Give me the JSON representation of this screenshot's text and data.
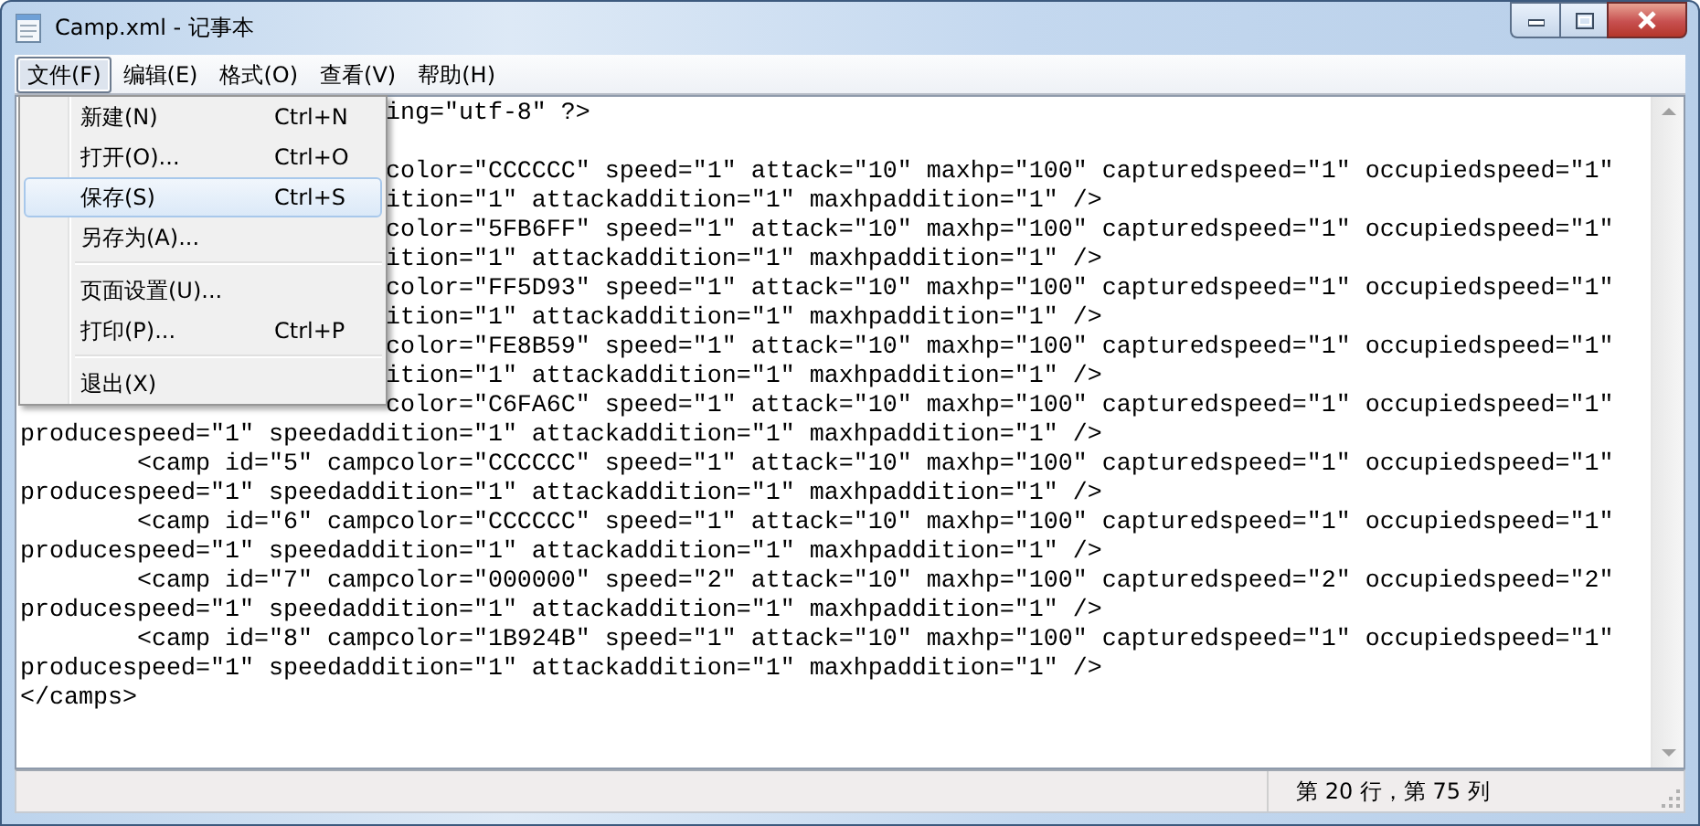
{
  "window": {
    "title": "Camp.xml - 记事本"
  },
  "menu_bar": [
    {
      "label": "文件(F)",
      "selected": true
    },
    {
      "label": "编辑(E)",
      "selected": false
    },
    {
      "label": "格式(O)",
      "selected": false
    },
    {
      "label": "查看(V)",
      "selected": false
    },
    {
      "label": "帮助(H)",
      "selected": false
    }
  ],
  "file_menu": [
    {
      "kind": "item",
      "label": "新建(N)",
      "shortcut": "Ctrl+N",
      "selected": false
    },
    {
      "kind": "item",
      "label": "打开(O)...",
      "shortcut": "Ctrl+O",
      "selected": false
    },
    {
      "kind": "item",
      "label": "保存(S)",
      "shortcut": "Ctrl+S",
      "selected": true
    },
    {
      "kind": "item",
      "label": "另存为(A)...",
      "selected": false
    },
    {
      "kind": "separator"
    },
    {
      "kind": "item",
      "label": "页面设置(U)...",
      "selected": false
    },
    {
      "kind": "item",
      "label": "打印(P)...",
      "shortcut": "Ctrl+P",
      "selected": false
    },
    {
      "kind": "separator"
    },
    {
      "kind": "item",
      "label": "退出(X)",
      "selected": false
    }
  ],
  "editor": {
    "lines": [
      {
        "kind": "under_menu",
        "text": "ing=\"utf-8\" ?>"
      },
      {
        "kind": "hidden"
      },
      {
        "kind": "under_menu",
        "text": "color=\"CCCCCC\" speed=\"1\" attack=\"10\" maxhp=\"100\" capturedspeed=\"1\" occupiedspeed=\"1\""
      },
      {
        "kind": "under_menu",
        "text": "ition=\"1\" attackaddition=\"1\" maxhpaddition=\"1\" />"
      },
      {
        "kind": "under_menu",
        "text": "color=\"5FB6FF\" speed=\"1\" attack=\"10\" maxhp=\"100\" capturedspeed=\"1\" occupiedspeed=\"1\""
      },
      {
        "kind": "under_menu",
        "text": "ition=\"1\" attackaddition=\"1\" maxhpaddition=\"1\" />"
      },
      {
        "kind": "under_menu",
        "text": "color=\"FF5D93\" speed=\"1\" attack=\"10\" maxhp=\"100\" capturedspeed=\"1\" occupiedspeed=\"1\""
      },
      {
        "kind": "under_menu",
        "text": "ition=\"1\" attackaddition=\"1\" maxhpaddition=\"1\" />"
      },
      {
        "kind": "under_menu",
        "text": "color=\"FE8B59\" speed=\"1\" attack=\"10\" maxhp=\"100\" capturedspeed=\"1\" occupiedspeed=\"1\""
      },
      {
        "kind": "under_menu",
        "text": "ition=\"1\" attackaddition=\"1\" maxhpaddition=\"1\" />"
      },
      {
        "kind": "under_menu",
        "text": "color=\"C6FA6C\" speed=\"1\" attack=\"10\" maxhp=\"100\" capturedspeed=\"1\" occupiedspeed=\"1\""
      },
      {
        "kind": "plain",
        "text": "producespeed=\"1\" speedaddition=\"1\" attackaddition=\"1\" maxhpaddition=\"1\" />"
      },
      {
        "kind": "indented",
        "text": "<camp id=\"5\" campcolor=\"CCCCCC\" speed=\"1\" attack=\"10\" maxhp=\"100\" capturedspeed=\"1\" occupiedspeed=\"1\""
      },
      {
        "kind": "plain",
        "text": "producespeed=\"1\" speedaddition=\"1\" attackaddition=\"1\" maxhpaddition=\"1\" />"
      },
      {
        "kind": "indented",
        "text": "<camp id=\"6\" campcolor=\"CCCCCC\" speed=\"1\" attack=\"10\" maxhp=\"100\" capturedspeed=\"1\" occupiedspeed=\"1\""
      },
      {
        "kind": "plain",
        "text": "producespeed=\"1\" speedaddition=\"1\" attackaddition=\"1\" maxhpaddition=\"1\" />"
      },
      {
        "kind": "indented",
        "text": "<camp id=\"7\" campcolor=\"000000\" speed=\"2\" attack=\"10\" maxhp=\"100\" capturedspeed=\"2\" occupiedspeed=\"2\""
      },
      {
        "kind": "plain",
        "text": "producespeed=\"1\" speedaddition=\"1\" attackaddition=\"1\" maxhpaddition=\"1\" />"
      },
      {
        "kind": "indented",
        "text": "<camp id=\"8\" campcolor=\"1B924B\" speed=\"1\" attack=\"10\" maxhp=\"100\" capturedspeed=\"1\" occupiedspeed=\"1\""
      },
      {
        "kind": "plain",
        "text": "producespeed=\"1\" speedaddition=\"1\" attackaddition=\"1\" maxhpaddition=\"1\" />"
      },
      {
        "kind": "plain",
        "text": "</camps>"
      }
    ]
  },
  "status_bar": {
    "position": "第 20 行，第 75 列"
  }
}
